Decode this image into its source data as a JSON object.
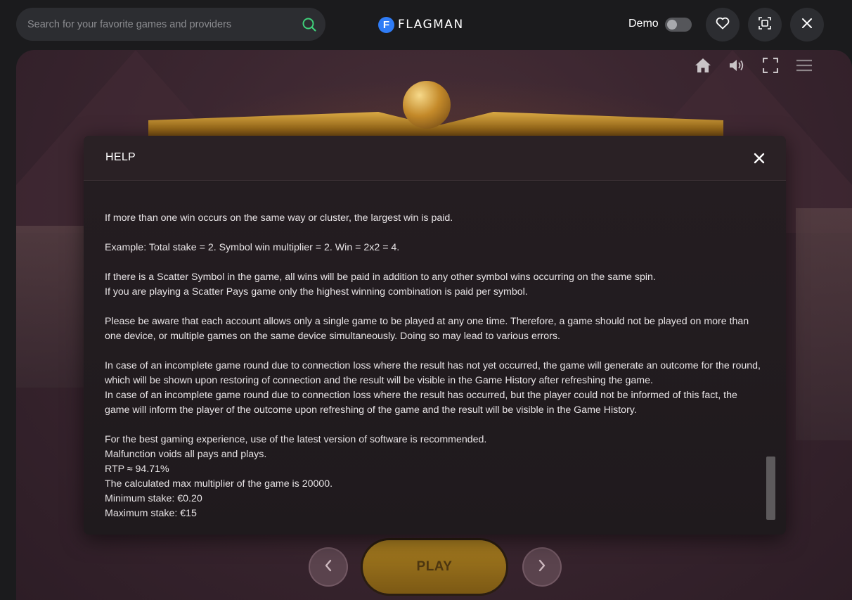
{
  "header": {
    "search_placeholder": "Search for your favorite games and providers",
    "brand_logo_letter": "F",
    "brand_name": "FLAGMAN",
    "demo_label": "Demo",
    "demo_enabled": false
  },
  "game": {
    "play_label": "PLAY"
  },
  "help": {
    "title": "HELP",
    "lines": [
      "If more than one win occurs on the same way or cluster, the largest win is paid.",
      "",
      "Example: Total stake = 2. Symbol win multiplier = 2. Win = 2x2 = 4.",
      "",
      "If there is a Scatter Symbol in the game, all wins will be paid in addition to any other symbol wins occurring on the same spin.",
      "If you are playing a Scatter Pays game only the highest winning combination is paid per symbol.",
      "",
      "Please be aware that each account allows only a single game to be played at any one time. Therefore, a game should not be played on more than",
      "one device, or multiple games on the same device simultaneously. Doing so may lead to various errors.",
      "",
      "In case of an incomplete game round due to connection loss where the result has not yet occurred, the game will generate an outcome for the round,",
      "which will be shown upon restoring of connection and the result will be visible in the Game History after refreshing the game.",
      "In case of an incomplete game round due to connection loss where the result has occurred, but the player could not be informed of this fact, the",
      "game will inform the player of the outcome upon refreshing of the game and the result will be visible in the Game History.",
      "",
      "For the best gaming experience, use of the latest version of software is recommended.",
      "Malfunction voids all pays and plays.",
      "RTP ≈ 94.71%",
      "The calculated max multiplier of the game is 20000.",
      "Minimum stake: €0.20",
      "Maximum stake: €15"
    ]
  },
  "colors": {
    "accent_search_icon": "#3fd07a",
    "brand_logo": "#2f7cf6",
    "play_button": "#a67c20"
  }
}
